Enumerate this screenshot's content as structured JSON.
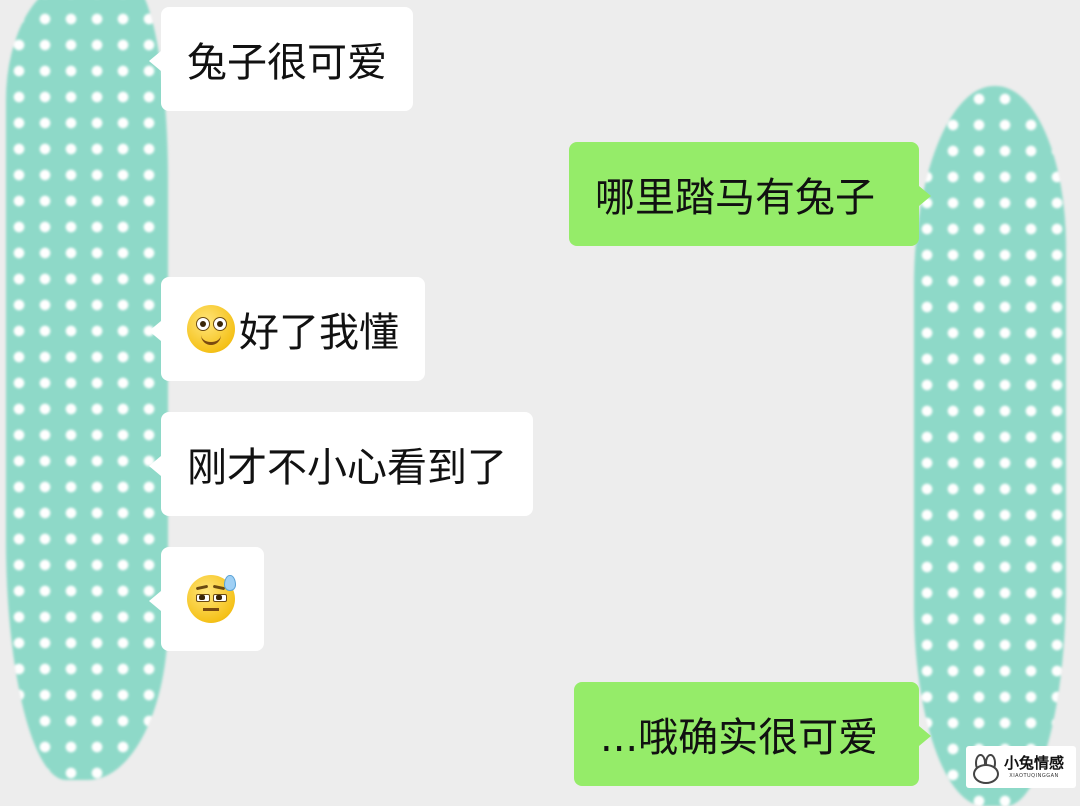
{
  "colors": {
    "background": "#ededed",
    "incoming_bubble": "#ffffff",
    "outgoing_bubble": "#95ec69",
    "censor_blob": "#8ed9c8"
  },
  "messages": [
    {
      "side": "left",
      "text": "兔子很可爱"
    },
    {
      "side": "right",
      "text": "哪里踏马有兔子"
    },
    {
      "side": "left",
      "emoji": "smile-emoji",
      "text": "好了我懂"
    },
    {
      "side": "left",
      "text": "刚才不小心看到了"
    },
    {
      "side": "left",
      "emoji": "sweat-emoji",
      "text": ""
    },
    {
      "side": "right",
      "text": "...哦确实很可爱"
    }
  ],
  "watermark": {
    "title": "小兔情感",
    "subtitle": "XIAOTUQINGGAN",
    "logo_icon": "rabbit-icon"
  }
}
